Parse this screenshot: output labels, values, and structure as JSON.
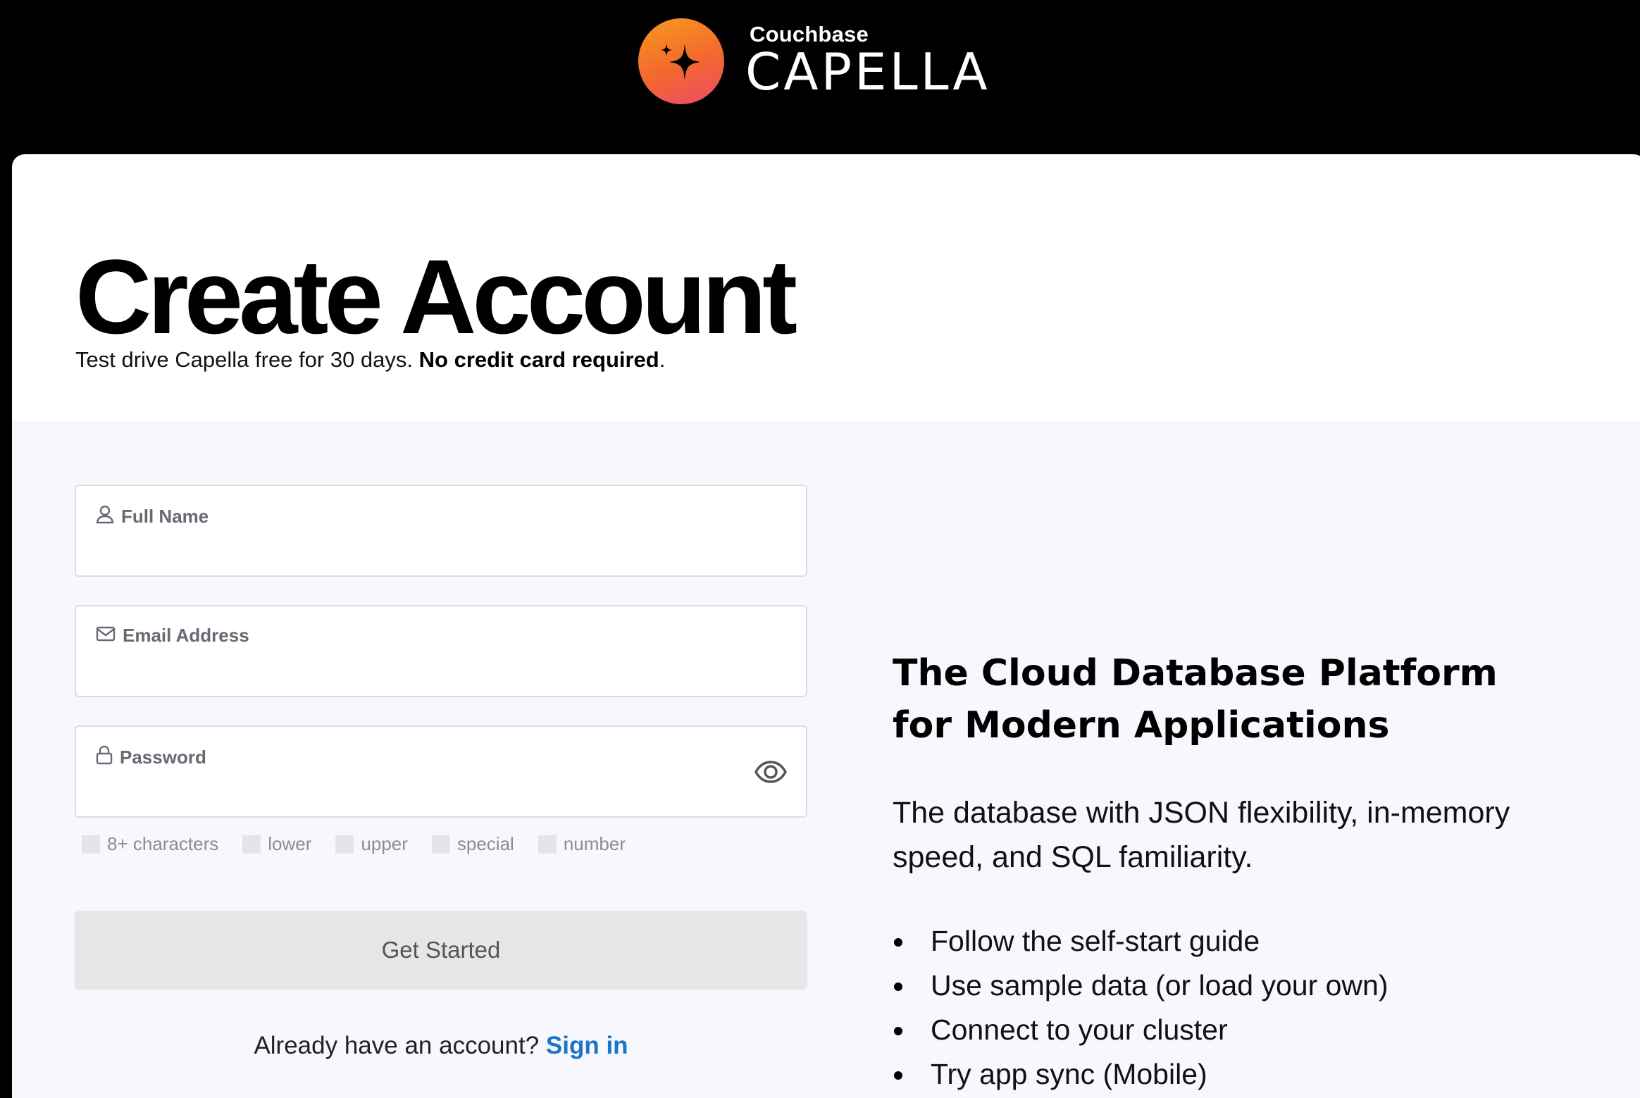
{
  "brand": {
    "small": "Couchbase",
    "big": "CAPELLA",
    "gradient": [
      "#f89a1c",
      "#f4672f",
      "#ea4b68"
    ]
  },
  "page": {
    "title": "Create Account",
    "subtitle_prefix": "Test drive Capella free for 30 days. ",
    "subtitle_bold": "No credit card required",
    "subtitle_suffix": "."
  },
  "form": {
    "full_name": {
      "label": "Full Name",
      "icon": "user-icon",
      "value": ""
    },
    "email": {
      "label": "Email Address",
      "icon": "envelope-icon",
      "value": ""
    },
    "password": {
      "label": "Password",
      "icon": "lock-icon",
      "toggle_icon": "eye-icon",
      "value": ""
    },
    "rules": [
      "8+ characters",
      "lower",
      "upper",
      "special",
      "number"
    ],
    "submit_label": "Get Started",
    "signin_prompt": "Already have an account? ",
    "signin_link": "Sign in",
    "link_color": "#1c74c6"
  },
  "pitch": {
    "title": "The Cloud Database Platform for Modern Applications",
    "body": "The database with JSON flexibility, in-memory speed, and SQL familiarity.",
    "items": [
      "Follow the self-start guide",
      "Use sample data (or load your own)",
      "Connect to your cluster",
      "Try app sync (Mobile)"
    ]
  }
}
